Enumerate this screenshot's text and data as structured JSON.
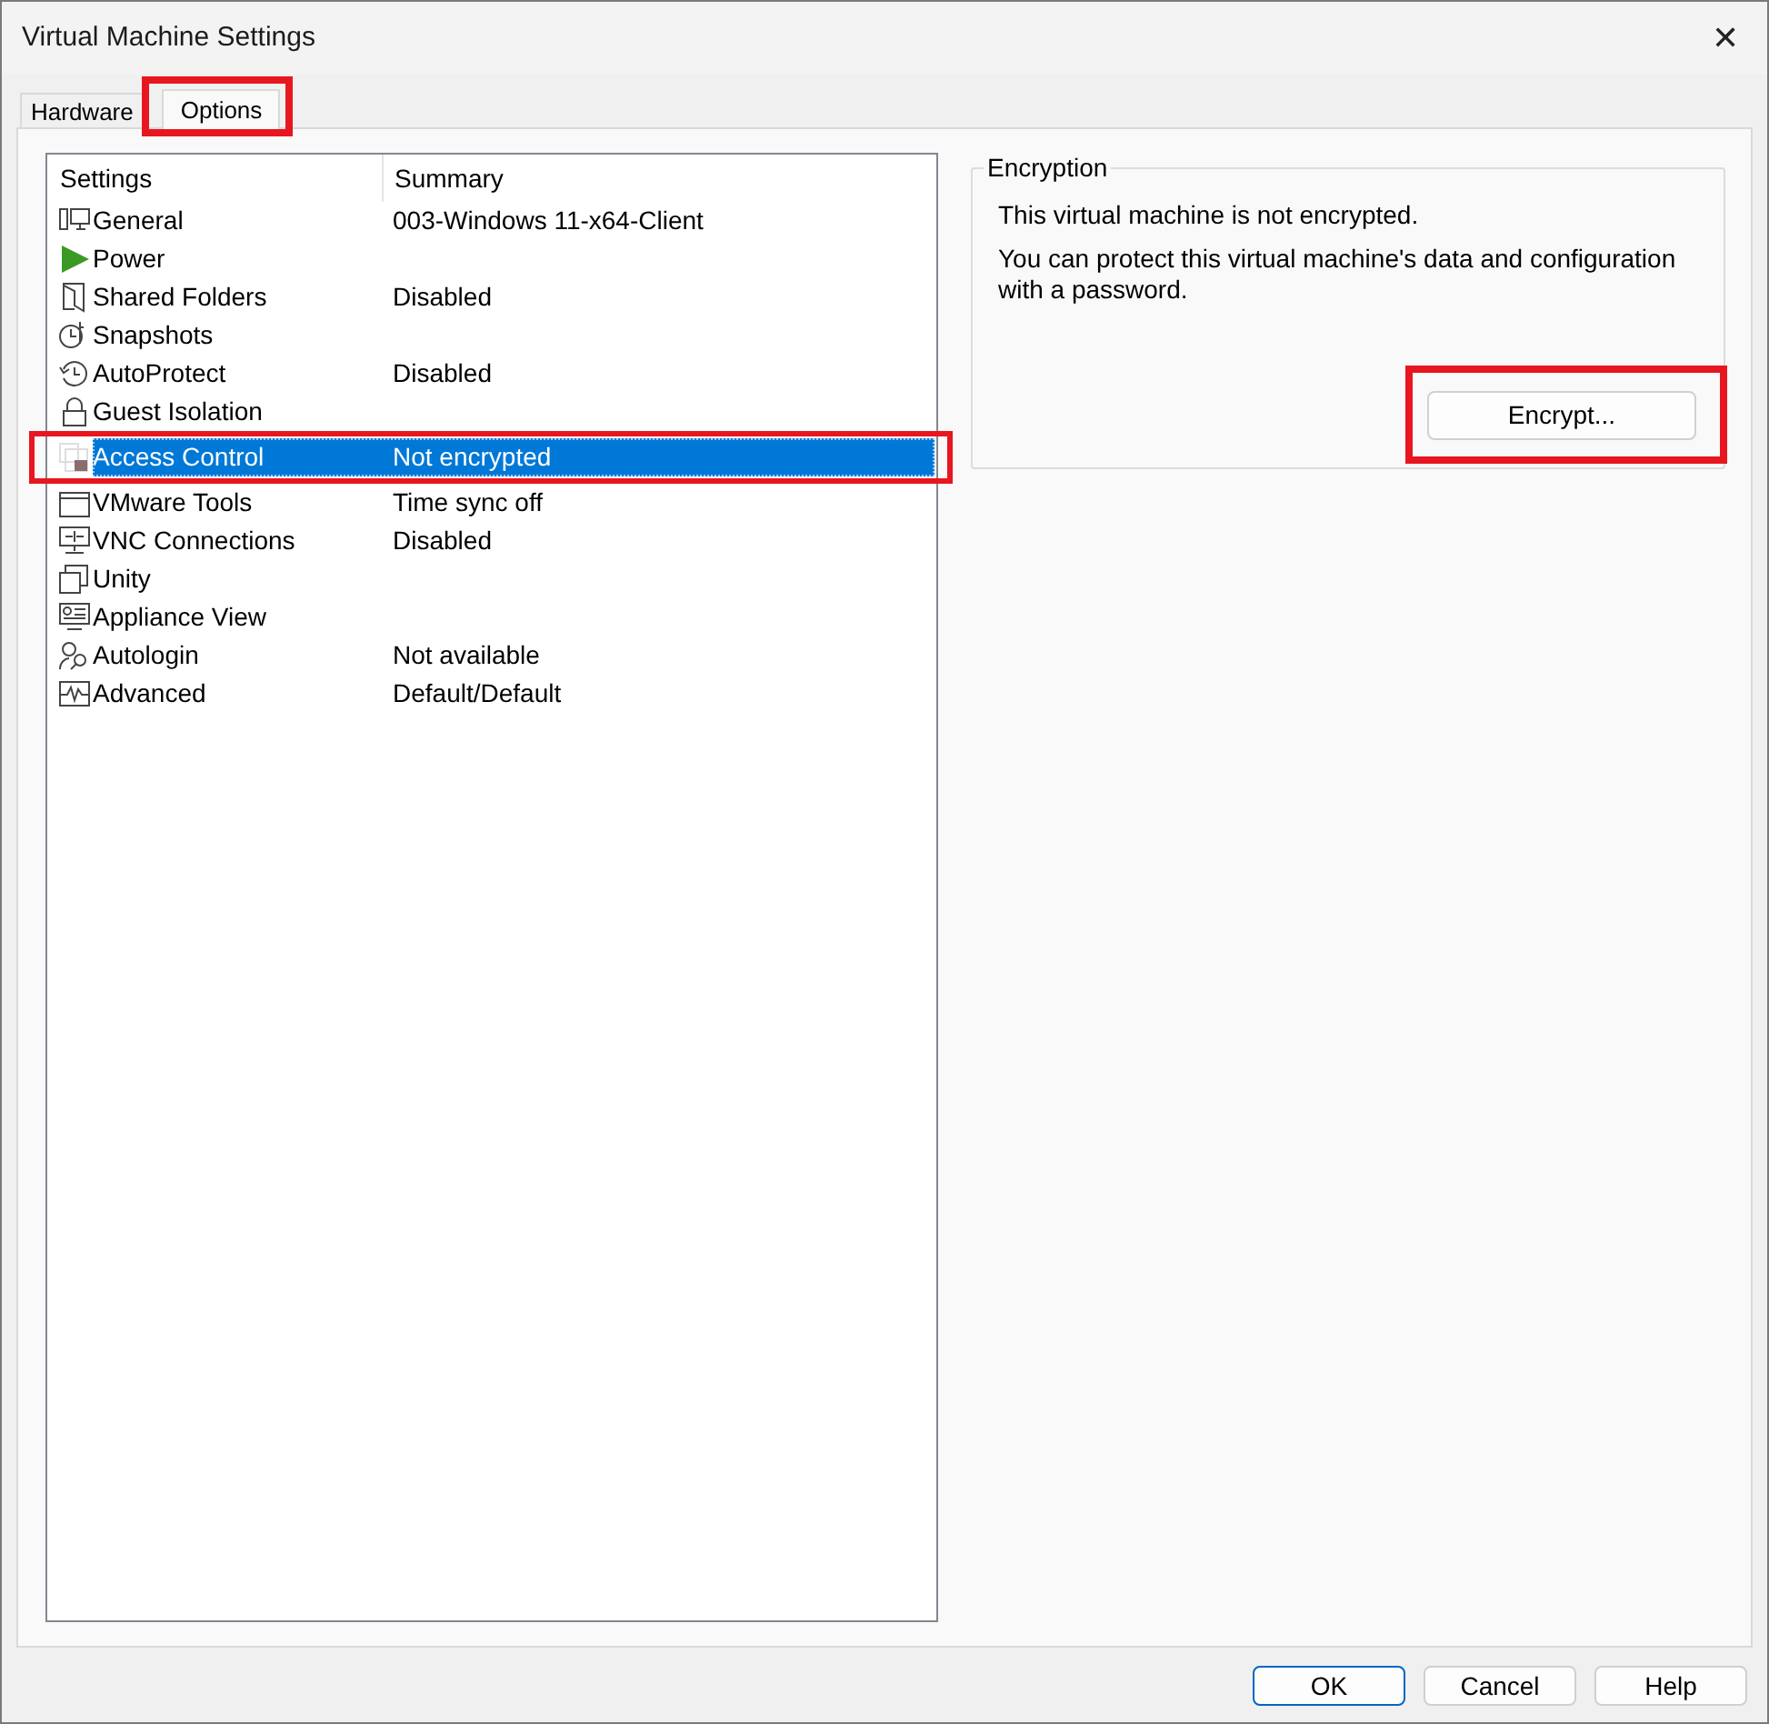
{
  "window": {
    "title": "Virtual Machine Settings",
    "close": "✕"
  },
  "tabs": [
    {
      "label": "Hardware",
      "selected": false
    },
    {
      "label": "Options",
      "selected": true
    }
  ],
  "settings_list": {
    "columns": [
      "Settings",
      "Summary"
    ],
    "rows": [
      {
        "setting": "General",
        "summary": "003-Windows 11-x64-Client",
        "selected": false
      },
      {
        "setting": "Power",
        "summary": "",
        "selected": false
      },
      {
        "setting": "Shared Folders",
        "summary": "Disabled",
        "selected": false
      },
      {
        "setting": "Snapshots",
        "summary": "",
        "selected": false
      },
      {
        "setting": "AutoProtect",
        "summary": "Disabled",
        "selected": false
      },
      {
        "setting": "Guest Isolation",
        "summary": "",
        "selected": false
      },
      {
        "setting": "Access Control",
        "summary": "Not encrypted",
        "selected": true
      },
      {
        "setting": "VMware Tools",
        "summary": "Time sync off",
        "selected": false
      },
      {
        "setting": "VNC Connections",
        "summary": "Disabled",
        "selected": false
      },
      {
        "setting": "Unity",
        "summary": "",
        "selected": false
      },
      {
        "setting": "Appliance View",
        "summary": "",
        "selected": false
      },
      {
        "setting": "Autologin",
        "summary": "Not available",
        "selected": false
      },
      {
        "setting": "Advanced",
        "summary": "Default/Default",
        "selected": false
      }
    ]
  },
  "encryption": {
    "title": "Encryption",
    "status": "This virtual machine is not encrypted.",
    "description": "You can protect this virtual machine's data and configuration with a password.",
    "button": "Encrypt..."
  },
  "buttons": [
    {
      "label": "OK",
      "default": true
    },
    {
      "label": "Cancel",
      "default": false
    },
    {
      "label": "Help",
      "default": false
    }
  ]
}
